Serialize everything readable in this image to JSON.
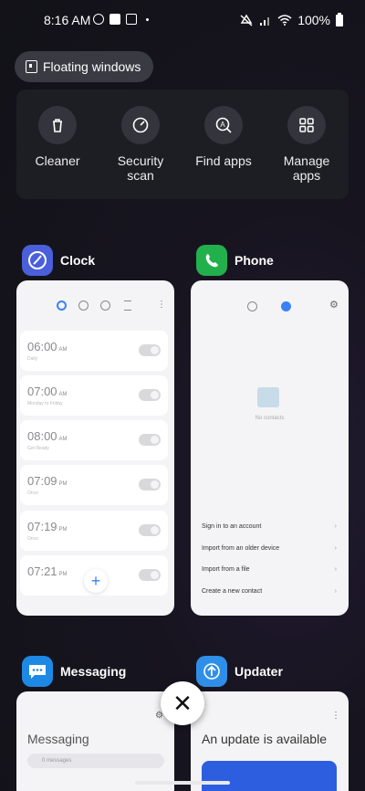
{
  "status_bar": {
    "time": "8:16 AM",
    "battery": "100%"
  },
  "floating_windows": {
    "label": "Floating windows"
  },
  "quick_actions": [
    {
      "label": "Cleaner",
      "icon": "trash-icon"
    },
    {
      "label": "Security scan",
      "icon": "shield-scan-icon"
    },
    {
      "label": "Find apps",
      "icon": "app-search-icon"
    },
    {
      "label": "Manage apps",
      "icon": "grid-icon"
    }
  ],
  "apps": {
    "clock": {
      "name": "Clock",
      "alarms": [
        {
          "time": "06:00",
          "ampm": "AM",
          "sub": "Daily"
        },
        {
          "time": "07:00",
          "ampm": "AM",
          "sub": "Monday to Friday"
        },
        {
          "time": "08:00",
          "ampm": "AM",
          "sub": "Get Ready"
        },
        {
          "time": "07:09",
          "ampm": "PM",
          "sub": "Once"
        },
        {
          "time": "07:19",
          "ampm": "PM",
          "sub": "Once"
        },
        {
          "time": "07:21",
          "ampm": "PM",
          "sub": ""
        }
      ],
      "add_label": "+"
    },
    "phone": {
      "name": "Phone",
      "empty_text": "No contacts",
      "options": [
        "Sign in to an account",
        "Import from an older device",
        "Import from a file",
        "Create a new contact"
      ]
    },
    "messaging": {
      "name": "Messaging",
      "title": "Messaging",
      "search_placeholder": "0 messages"
    },
    "updater": {
      "name": "Updater",
      "title": "An update is available"
    }
  },
  "close_label": "✕",
  "colors": {
    "clock_icon": "#4a5fd9",
    "phone_icon": "#22b04c",
    "messaging_icon": "#1e88e5",
    "updater_icon": "#2f8fe8"
  }
}
